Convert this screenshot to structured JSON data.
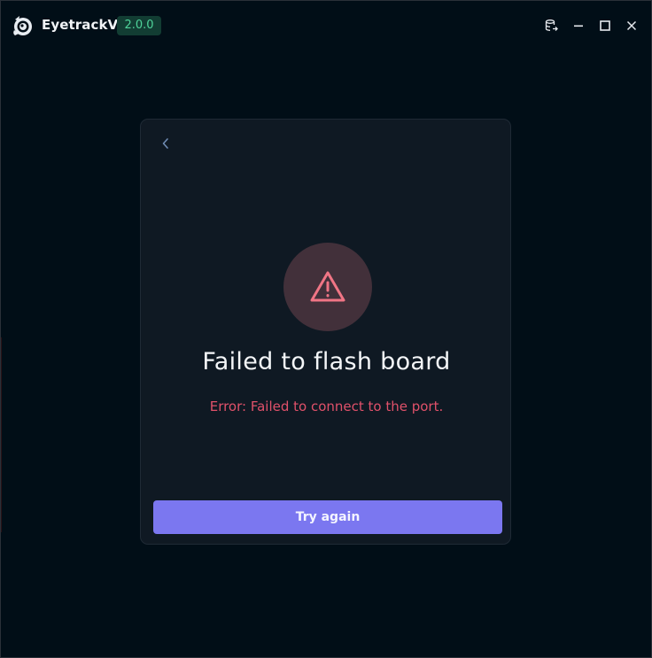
{
  "app": {
    "title": "EyetrackVR",
    "version": "2.0.0",
    "logo_icon": "eye-logo-icon"
  },
  "titlebar": {
    "buttons": [
      {
        "name": "database-export-icon"
      },
      {
        "name": "minimize-icon"
      },
      {
        "name": "maximize-icon"
      },
      {
        "name": "close-icon"
      }
    ]
  },
  "card": {
    "back_icon": "chevron-left-icon",
    "alert_icon": "warning-triangle-icon",
    "title": "Failed to flash board",
    "error": "Error: Failed to connect to the port.",
    "button_label": "Try again"
  },
  "colors": {
    "background": "#010e17",
    "card": "#0f1923",
    "accent": "#7b77f0",
    "error": "#e0516a",
    "badge_bg": "#123d33",
    "badge_text": "#4fd39a",
    "alert_circle": "#42303a",
    "alert_icon": "#f07585"
  }
}
